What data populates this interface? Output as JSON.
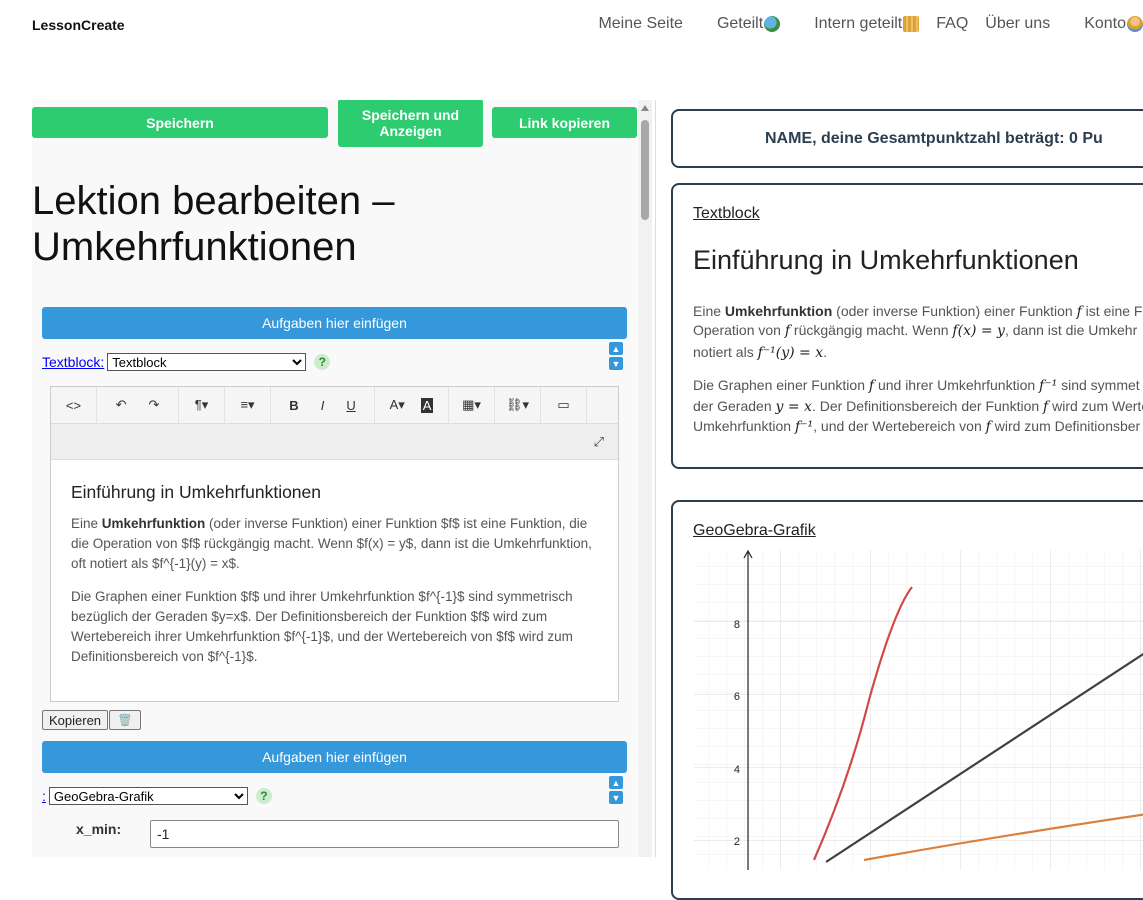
{
  "nav": {
    "brand": "LessonCreate",
    "links": [
      "Meine Seite",
      "Geteilt",
      "Intern geteilt",
      "FAQ",
      "Über uns",
      "Konto"
    ]
  },
  "toolbar": {
    "save": "Speichern",
    "save_show": "Speichern und Anzeigen",
    "copy_link": "Link kopieren"
  },
  "editor_page": {
    "title": "Lektion bearbeiten – Umkehrfunktionen",
    "insert_tasks": "Aufgaben hier einfügen",
    "block1_link": "Textblock:",
    "block1_type": "Textblock",
    "block2_link": ":",
    "block2_type": "GeoGebra-Grafik",
    "help": "?",
    "copy_btn": "Kopieren",
    "xmin_label": "x_min:",
    "xmin_value": "-1"
  },
  "rte": {
    "heading": "Einführung in Umkehrfunktionen",
    "p1_pre": "Eine ",
    "p1_bold": "Umkehrfunktion",
    "p1_post": " (oder inverse Funktion) einer Funktion $f$ ist eine Funktion, die die Operation von $f$ rückgängig macht. Wenn $f(x) = y$, dann ist die Umkehrfunktion, oft notiert als $f^{-1}(y) = x$.",
    "p2": "Die Graphen einer Funktion $f$ und ihrer Umkehrfunktion $f^{-1}$ sind symmetrisch bezüglich der Geraden $y=x$. Der Definitionsbereich der Funktion $f$ wird zum Wertebereich ihrer Umkehrfunktion $f^{-1}$, und der Wertebereich von $f$ wird zum Definitionsbereich von $f^{-1}$."
  },
  "preview": {
    "score": "NAME, deine Gesamtpunktzahl beträgt: 0 Pu",
    "text_label": "Textblock",
    "heading": "Einführung in Umkehrfunktionen",
    "l1a": "Eine ",
    "l1b": "Umkehrfunktion",
    "l1c": " (oder inverse Funktion) einer Funktion ",
    "l1d": " ist eine Fu",
    "l2a": "Operation von ",
    "l2b": " rückgängig macht. Wenn ",
    "l2c": ", dann ist die Umkehr",
    "l3a": "notiert als ",
    "l4a": "Die Graphen einer Funktion ",
    "l4b": " und ihrer Umkehrfunktion ",
    "l4c": " sind symmet",
    "l5a": "der Geraden ",
    "l5b": ". Der Definitionsbereich der Funktion ",
    "l5c": " wird zum Werte",
    "l6a": "Umkehrfunktion ",
    "l6b": ", und der Wertebereich von ",
    "l6c": " wird zum Definitionsber",
    "m_f": "f",
    "m_fx": "f(x) = y",
    "m_finv": "f⁻¹(y) = x",
    "m_f1": "f⁻¹",
    "m_yx": "y = x",
    "geo_label": "GeoGebra-Grafik"
  },
  "graph": {
    "y_ticks": [
      "8",
      "6",
      "4",
      "2"
    ],
    "colors": {
      "red": "#d04a4a",
      "dark": "#404040",
      "orange": "#d98040"
    }
  }
}
